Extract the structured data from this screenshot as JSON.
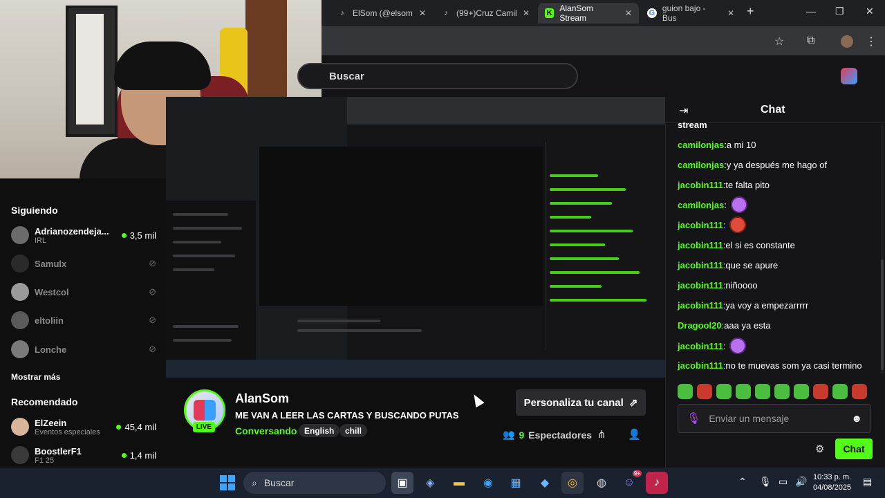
{
  "browser": {
    "tabs": [
      {
        "label": "ElSom (@elsom",
        "icon": "tiktok-icon"
      },
      {
        "label": "(99+)Cruz Camil",
        "icon": "tiktok-icon"
      },
      {
        "label": "AlanSom Stream",
        "icon": "kick-icon",
        "active": true
      },
      {
        "label": "guion bajo - Bus",
        "icon": "google-icon"
      }
    ],
    "new_tab": "+",
    "win_min": "—",
    "win_max": "❐",
    "win_close": "✕"
  },
  "header": {
    "search_placeholder": "Buscar"
  },
  "sidebar": {
    "following_title": "Siguiendo",
    "following": [
      {
        "name": "Adrianozendeja...",
        "sub": "IRL",
        "viewers": "3,5 mil",
        "live": true
      },
      {
        "name": "Samulx",
        "live": false
      },
      {
        "name": "Westcol",
        "live": false
      },
      {
        "name": "eltoliin",
        "live": false
      },
      {
        "name": "Lonche",
        "live": false
      }
    ],
    "show_more": "Mostrar más",
    "recommended_title": "Recomendado",
    "recommended": [
      {
        "name": "ElZeein",
        "sub": "Eventos especiales",
        "viewers": "45,4 mil"
      },
      {
        "name": "BoostlerF1",
        "sub": "F1 25",
        "viewers": "1,4 mil"
      }
    ]
  },
  "stream": {
    "channel": "AlanSom",
    "title": "ME VAN A LEER LAS CARTAS Y BUSCANDO PUTAS",
    "category": "Conversando",
    "tags": [
      "English",
      "chill"
    ],
    "live_badge": "LIVE",
    "customize_label": "Personaliza tu canal",
    "viewers_count": "9",
    "viewers_label": "Espectadores"
  },
  "chat": {
    "title": "Chat",
    "top_cut": "stream",
    "messages": [
      {
        "user": "camilonjas",
        "text": " a mi 10"
      },
      {
        "user": "camilonjas",
        "text": " y ya después me hago of"
      },
      {
        "user": "jacobin111",
        "text": " te falta pito"
      },
      {
        "user": "camilonjas",
        "text": "",
        "emote": "purple"
      },
      {
        "user": "jacobin111",
        "text": "",
        "emote": "red"
      },
      {
        "user": "jacobin111",
        "text": " el si es constante"
      },
      {
        "user": "jacobin111",
        "text": " que se apure"
      },
      {
        "user": "jacobin111",
        "text": " niñoooo"
      },
      {
        "user": "jacobin111",
        "text": " ya voy a empezarrrrr"
      },
      {
        "user": "Dragool20",
        "text": " aaa ya esta"
      },
      {
        "user": "jacobin111",
        "text": "",
        "emote": "purple"
      },
      {
        "user": "jacobin111",
        "text": " no te muevas som ya casi termino"
      }
    ],
    "input_placeholder": "Enviar un mensaje",
    "send_label": "Chat"
  },
  "taskbar": {
    "search_label": "Buscar",
    "time": "10:33 p. m.",
    "date": "04/08/2025",
    "badge": "9+"
  },
  "colors": {
    "accent": "#53fc18",
    "background": "#0f0f10"
  }
}
